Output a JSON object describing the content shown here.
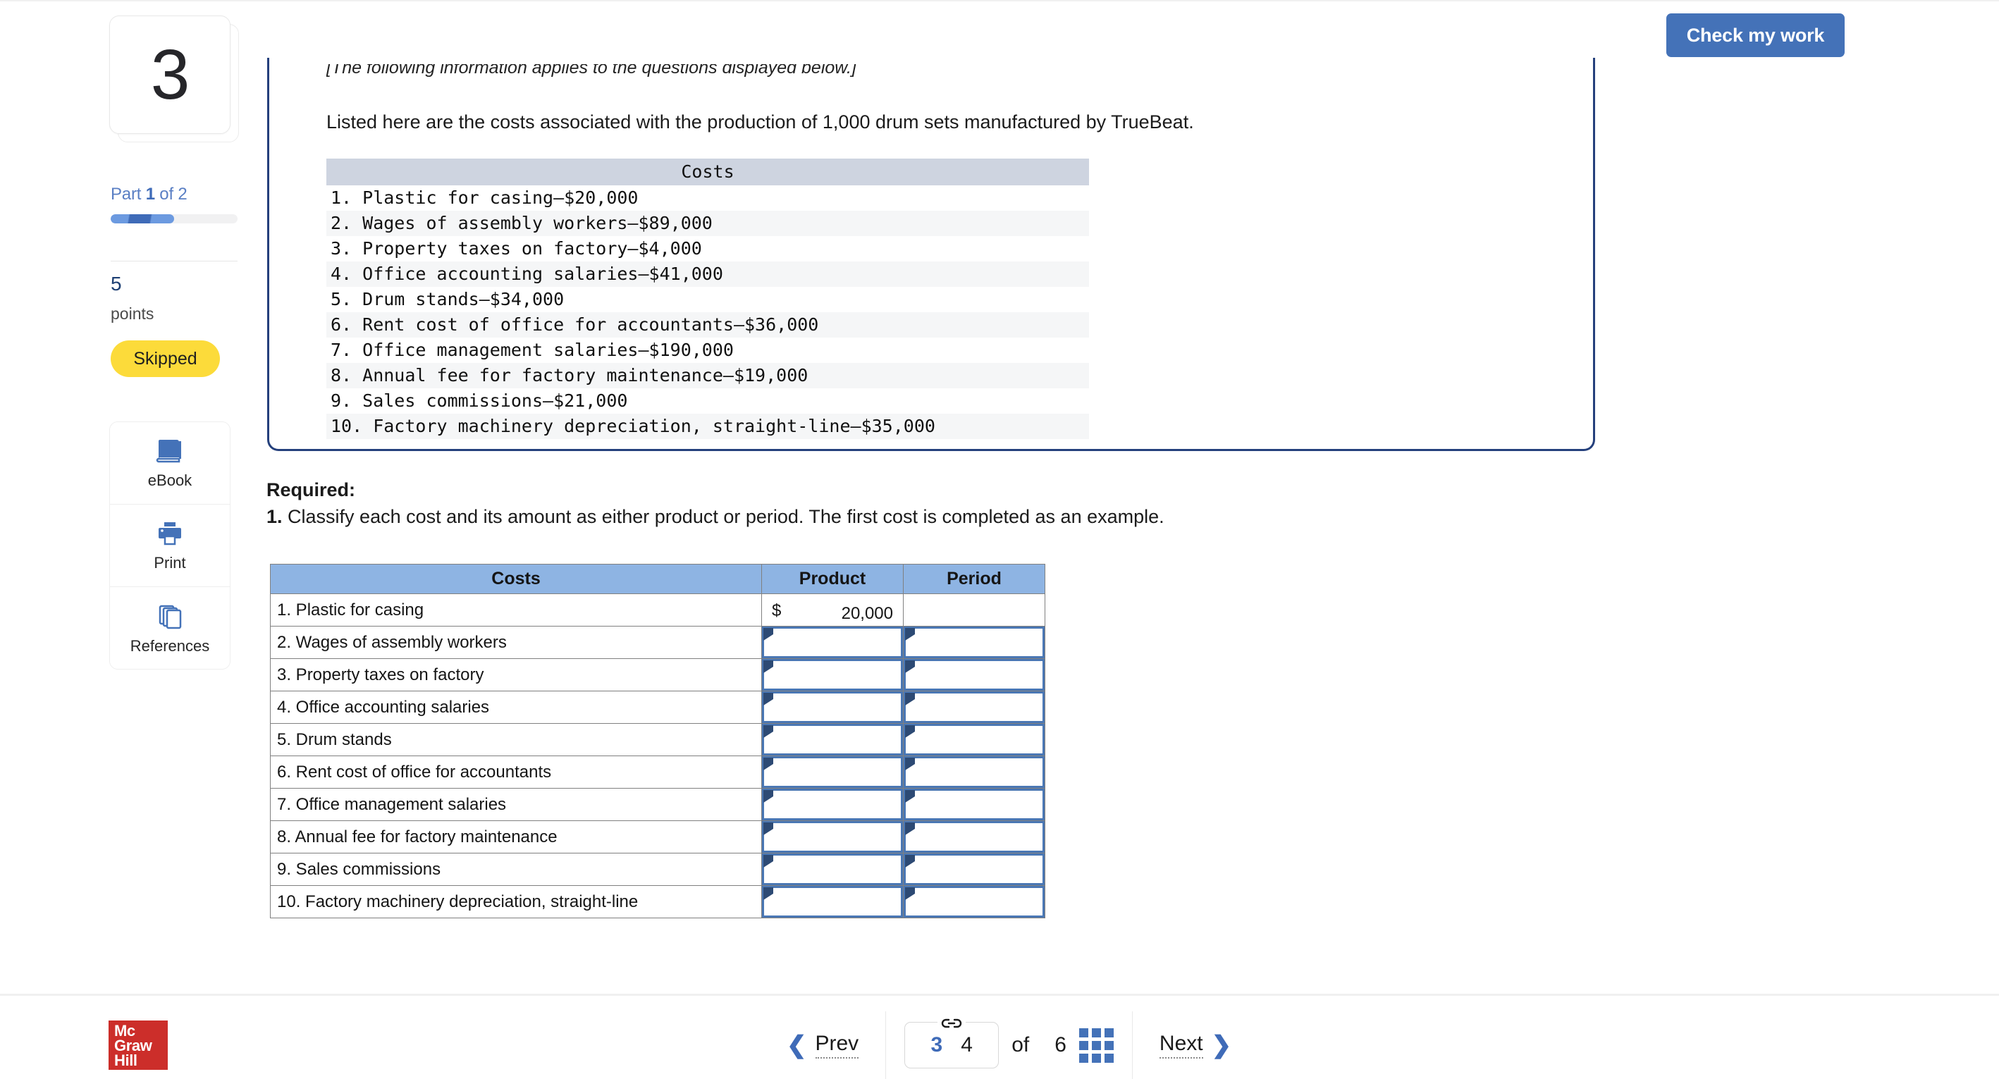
{
  "toolbar": {
    "check_my_work_label": "Check my work"
  },
  "rail": {
    "question_number": "3",
    "part_prefix": "Part ",
    "part_current": "1",
    "part_suffix": " of 2",
    "progress_percent": 50,
    "points_value": "5",
    "points_label": "points",
    "status_badge": "Skipped",
    "tools": [
      {
        "icon": "ebook-icon",
        "label": "eBook"
      },
      {
        "icon": "print-icon",
        "label": "Print"
      },
      {
        "icon": "references-icon",
        "label": "References"
      }
    ]
  },
  "question": {
    "italic_note": "[The following information applies to the questions displayed below.]",
    "intro": "Listed here are the costs associated with the production of 1,000 drum sets manufactured by TrueBeat.",
    "costs_header": "Costs",
    "costs_list": [
      "1. Plastic for casing—$20,000",
      "2. Wages of assembly workers—$89,000",
      "3. Property taxes on factory—$4,000",
      "4. Office accounting salaries—$41,000",
      "5. Drum stands—$34,000",
      "6. Rent cost of office for accountants—$36,000",
      "7. Office management salaries—$190,000",
      "8. Annual fee for factory maintenance—$19,000",
      "9. Sales commissions—$21,000",
      "10. Factory machinery depreciation, straight-line—$35,000"
    ]
  },
  "required": {
    "title": "Required:",
    "item_number": "1.",
    "item_text": " Classify each cost and its amount as either product or period. The first cost is completed as an example."
  },
  "answer_table": {
    "columns": [
      "Costs",
      "Product",
      "Period"
    ],
    "rows": [
      {
        "cost": "1. Plastic for casing",
        "product_currency": "$",
        "product_value": "20,000",
        "product_filled": true,
        "period_filled": false,
        "example": true
      },
      {
        "cost": "2. Wages of assembly workers",
        "product_value": "",
        "period_value": "",
        "example": false
      },
      {
        "cost": "3. Property taxes on factory",
        "product_value": "",
        "period_value": "",
        "example": false
      },
      {
        "cost": "4. Office accounting salaries",
        "product_value": "",
        "period_value": "",
        "example": false
      },
      {
        "cost": "5. Drum stands",
        "product_value": "",
        "period_value": "",
        "example": false
      },
      {
        "cost": "6. Rent cost of office for accountants",
        "product_value": "",
        "period_value": "",
        "example": false
      },
      {
        "cost": "7. Office management salaries",
        "product_value": "",
        "period_value": "",
        "example": false
      },
      {
        "cost": "8. Annual fee for factory maintenance",
        "product_value": "",
        "period_value": "",
        "example": false
      },
      {
        "cost": "9. Sales commissions",
        "product_value": "",
        "period_value": "",
        "example": false
      },
      {
        "cost": "10. Factory machinery depreciation, straight-line",
        "product_value": "",
        "period_value": "",
        "example": false
      }
    ]
  },
  "footer": {
    "logo_line1": "Mc",
    "logo_line2": "Graw",
    "logo_line3": "Hill",
    "prev_label": "Prev",
    "next_label": "Next",
    "page_current": "3",
    "page_linked": "4",
    "of_label": "of",
    "page_total": "6"
  },
  "colors": {
    "accent_blue": "#4472b8",
    "header_blue": "#8eb4e3",
    "box_border_navy": "#25407c",
    "badge_yellow": "#fcdb3a",
    "logo_red": "#cc2e2a",
    "input_border": "#4a77b4"
  }
}
